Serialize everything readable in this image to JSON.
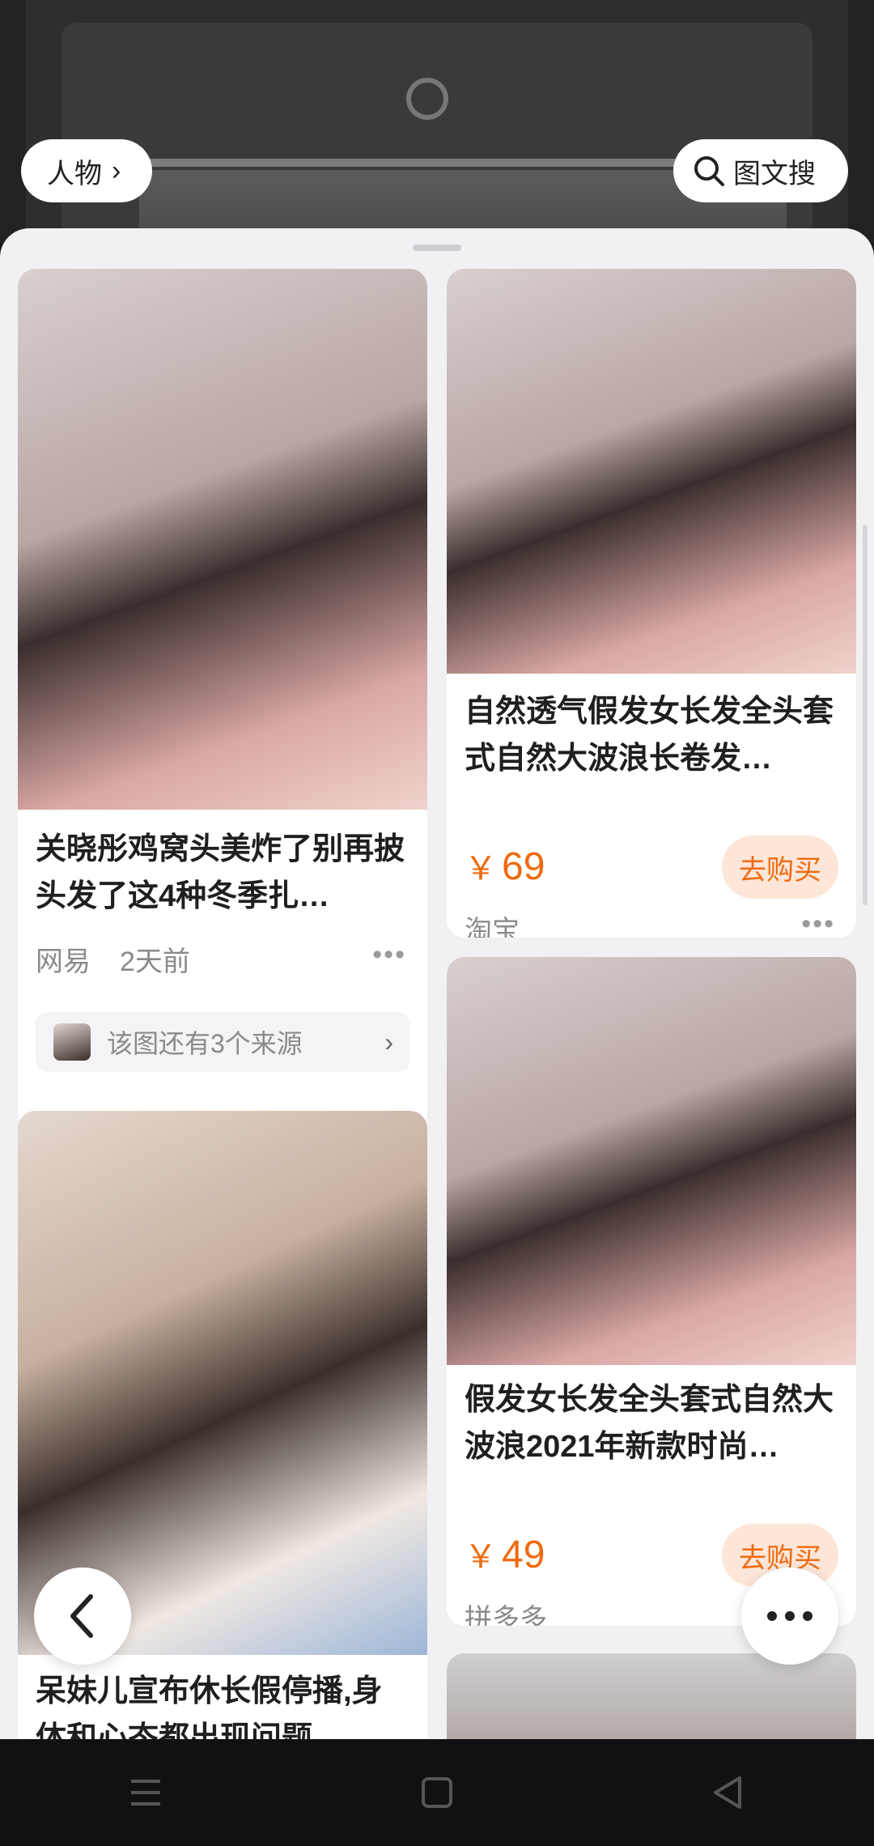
{
  "top": {
    "category_label": "人物",
    "category_chevron": "›",
    "image_text_search_label": "图文搜",
    "icons": {
      "search": "search-icon",
      "chevron": "chevron-right-icon"
    }
  },
  "left_column": [
    {
      "title": "关晓彤鸡窝头美炸了别再披头发了这4种冬季扎…",
      "source": "网易",
      "time": "2天前",
      "more": "•••",
      "sources_text": "该图还有3个来源",
      "sources_chevron": "›"
    },
    {
      "title": "呆妹儿宣布休长假停播,身体和心态都出现问题…"
    }
  ],
  "right_column": [
    {
      "title": "自然透气假发女长发全头套式自然大波浪长卷发…",
      "price_symbol": "￥",
      "price": "69",
      "buy_label": "去购买",
      "store": "淘宝",
      "more": "•••"
    },
    {
      "title": "假发女长发全头套式自然大波浪2021年新款时尚…",
      "price_symbol": "￥",
      "price": "49",
      "buy_label": "去购买",
      "store": "拼多多",
      "more": "•••"
    }
  ],
  "floating": {
    "back_icon": "chevron-left-icon",
    "more_icon": "more-dots-icon"
  },
  "colors": {
    "accent": "#f06a0f",
    "buy_bg": "#fde6d8",
    "sheet_bg": "#f1f1f3"
  }
}
